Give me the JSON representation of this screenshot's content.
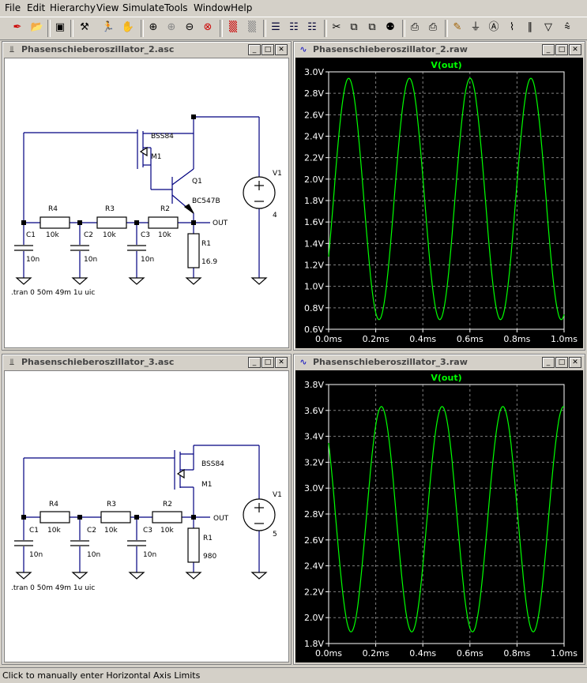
{
  "menu": [
    "File",
    "Edit",
    "Hierarchy",
    "View",
    "Simulate",
    "Tools",
    "Window",
    "Help"
  ],
  "toolbar_icons": [
    "new-schematic-icon",
    "open-icon",
    "save-icon",
    "control-panel-icon",
    "run-icon",
    "halt-icon",
    "zoom-in-icon",
    "zoom-out-icon",
    "zoom-fit-icon",
    "zoom-cancel-icon",
    "waveform-icon",
    "autorange-icon",
    "tile-horizontal-icon",
    "cascade-icon",
    "tile-vertical-icon",
    "cut-icon",
    "copy-icon",
    "paste-icon",
    "find-icon",
    "print-preview-icon",
    "print-icon",
    "draw-wire-icon",
    "ground-icon",
    "label-icon",
    "resistor-icon",
    "capacitor-icon",
    "diode-icon"
  ],
  "windows": {
    "schem2_title": "Phasenschieberoszillator_2.asc",
    "plot2_title": "Phasenschieberoszillator_2.raw",
    "schem3_title": "Phasenschieberoszillator_3.asc",
    "plot3_title": "Phasenschieberoszillator_3.raw"
  },
  "schem2": {
    "mosfet_model": "BSS84",
    "mosfet_ref": "M1",
    "bjt_ref": "Q1",
    "bjt_model": "BC547B",
    "v_ref": "V1",
    "v_value": "4",
    "r4": "R4",
    "r4v": "10k",
    "r3": "R3",
    "r3v": "10k",
    "r2": "R2",
    "r2v": "10k",
    "r1": "R1",
    "r1v": "16.9",
    "c1": "C1",
    "c1v": "10n",
    "c2": "C2",
    "c2v": "10n",
    "c3": "C3",
    "c3v": "10n",
    "net": "OUT",
    "directive": ".tran 0 50m 49m 1u uic"
  },
  "schem3": {
    "mosfet_model": "BSS84",
    "mosfet_ref": "M1",
    "v_ref": "V1",
    "v_value": "5",
    "r4": "R4",
    "r4v": "10k",
    "r3": "R3",
    "r3v": "10k",
    "r2": "R2",
    "r2v": "10k",
    "r1": "R1",
    "r1v": "980",
    "c1": "C1",
    "c1v": "10n",
    "c2": "C2",
    "c2v": "10n",
    "c3": "C3",
    "c3v": "10n",
    "net": "OUT",
    "directive": ".tran 0 50m 49m 1u uic"
  },
  "colors": {
    "trace": "#00ff00",
    "plot_bg": "#000000",
    "grid": "#7f7f7f",
    "axis_text": "#ffffff"
  },
  "chart_data": [
    {
      "type": "line",
      "title": "V(out)",
      "x_ticks": [
        "0.0ms",
        "0.2ms",
        "0.4ms",
        "0.6ms",
        "0.8ms",
        "1.0ms"
      ],
      "y_ticks": [
        "3.0V",
        "2.8V",
        "2.6V",
        "2.4V",
        "2.2V",
        "2.0V",
        "1.8V",
        "1.6V",
        "1.4V",
        "1.2V",
        "1.0V",
        "0.8V",
        "0.6V"
      ],
      "xlim": [
        0,
        1.0
      ],
      "ylim": [
        0.6,
        3.0
      ],
      "series": [
        {
          "name": "V(out)",
          "min": 0.69,
          "max": 2.94,
          "period_ms": 0.258,
          "first_peak_ms": 0.085
        }
      ]
    },
    {
      "type": "line",
      "title": "V(out)",
      "x_ticks": [
        "0.0ms",
        "0.2ms",
        "0.4ms",
        "0.6ms",
        "0.8ms",
        "1.0ms"
      ],
      "y_ticks": [
        "3.8V",
        "3.6V",
        "3.4V",
        "3.2V",
        "3.0V",
        "2.8V",
        "2.6V",
        "2.4V",
        "2.2V",
        "2.0V",
        "1.8V"
      ],
      "xlim": [
        0,
        1.0
      ],
      "ylim": [
        1.8,
        3.8
      ],
      "series": [
        {
          "name": "V(out)",
          "min": 1.89,
          "max": 3.63,
          "period_ms": 0.258,
          "first_peak_ms": 0.224
        }
      ]
    }
  ],
  "status": "Click to manually enter Horizontal Axis Limits"
}
